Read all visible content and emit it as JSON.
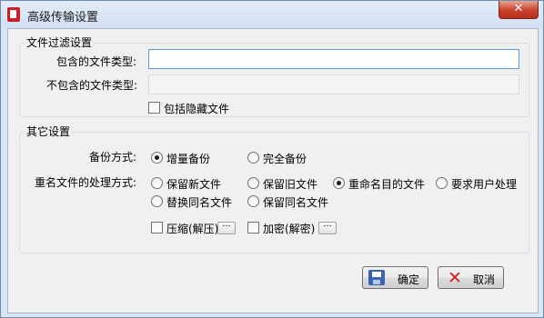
{
  "window": {
    "title": "高级传输设置",
    "close_glyph": "✕"
  },
  "file_filter": {
    "group_label": "文件过滤设置",
    "include_label": "包含的文件类型:",
    "include_value": "",
    "exclude_label": "不包含的文件类型:",
    "exclude_value": "",
    "include_hidden": {
      "label": "包括隐藏文件",
      "checked": false
    }
  },
  "other": {
    "group_label": "其它设置",
    "backup_label": "备份方式:",
    "backup_options": [
      {
        "label": "增量备份",
        "selected": true
      },
      {
        "label": "完全备份",
        "selected": false
      }
    ],
    "rename_label": "重名文件的处理方式:",
    "rename_options": [
      {
        "label": "保留新文件",
        "selected": false
      },
      {
        "label": "保留旧文件",
        "selected": false
      },
      {
        "label": "重命名目的文件",
        "selected": true
      },
      {
        "label": "要求用户处理",
        "selected": false
      },
      {
        "label": "替换同名文件",
        "selected": false
      },
      {
        "label": "保留同名文件",
        "selected": false
      }
    ],
    "compress": {
      "label": "压缩(解压)",
      "checked": false
    },
    "encrypt": {
      "label": "加密(解密)",
      "checked": false
    },
    "ellipsis": "···"
  },
  "buttons": {
    "ok": "确定",
    "cancel": "取消",
    "cancel_glyph": "✕"
  },
  "icons": {
    "app": "app-icon",
    "ok": "save-icon",
    "cancel": "x-icon"
  },
  "colors": {
    "titlebar": "#d2e0f2",
    "close": "#c7402a",
    "focus_border": "#569de5"
  }
}
